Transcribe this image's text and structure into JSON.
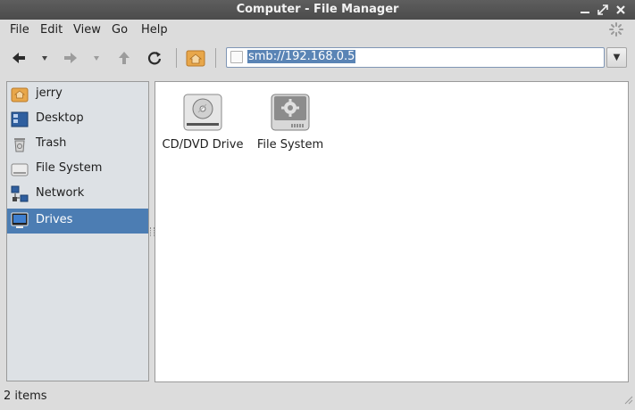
{
  "window": {
    "title": "Computer - File Manager"
  },
  "menu": {
    "items": [
      "File",
      "Edit",
      "View",
      "Go",
      "Help"
    ]
  },
  "location": {
    "value": "smb://192.168.0.5"
  },
  "sidebar": {
    "items": [
      {
        "label": "jerry",
        "icon": "home-folder-icon"
      },
      {
        "label": "Desktop",
        "icon": "desktop-icon"
      },
      {
        "label": "Trash",
        "icon": "trash-icon"
      },
      {
        "label": "File System",
        "icon": "filesystem-icon"
      },
      {
        "label": "Network",
        "icon": "network-icon"
      },
      {
        "label": "Drives",
        "icon": "drives-icon",
        "active": true
      }
    ]
  },
  "files": [
    {
      "label": "CD/DVD Drive",
      "icon": "optical-drive-icon"
    },
    {
      "label": "File System",
      "icon": "harddisk-icon"
    }
  ],
  "status": {
    "text": "2 items"
  },
  "colors": {
    "selection": "#4c7db3",
    "titlebar": "#4f4f4f",
    "accent_folder": "#e8a74a"
  }
}
